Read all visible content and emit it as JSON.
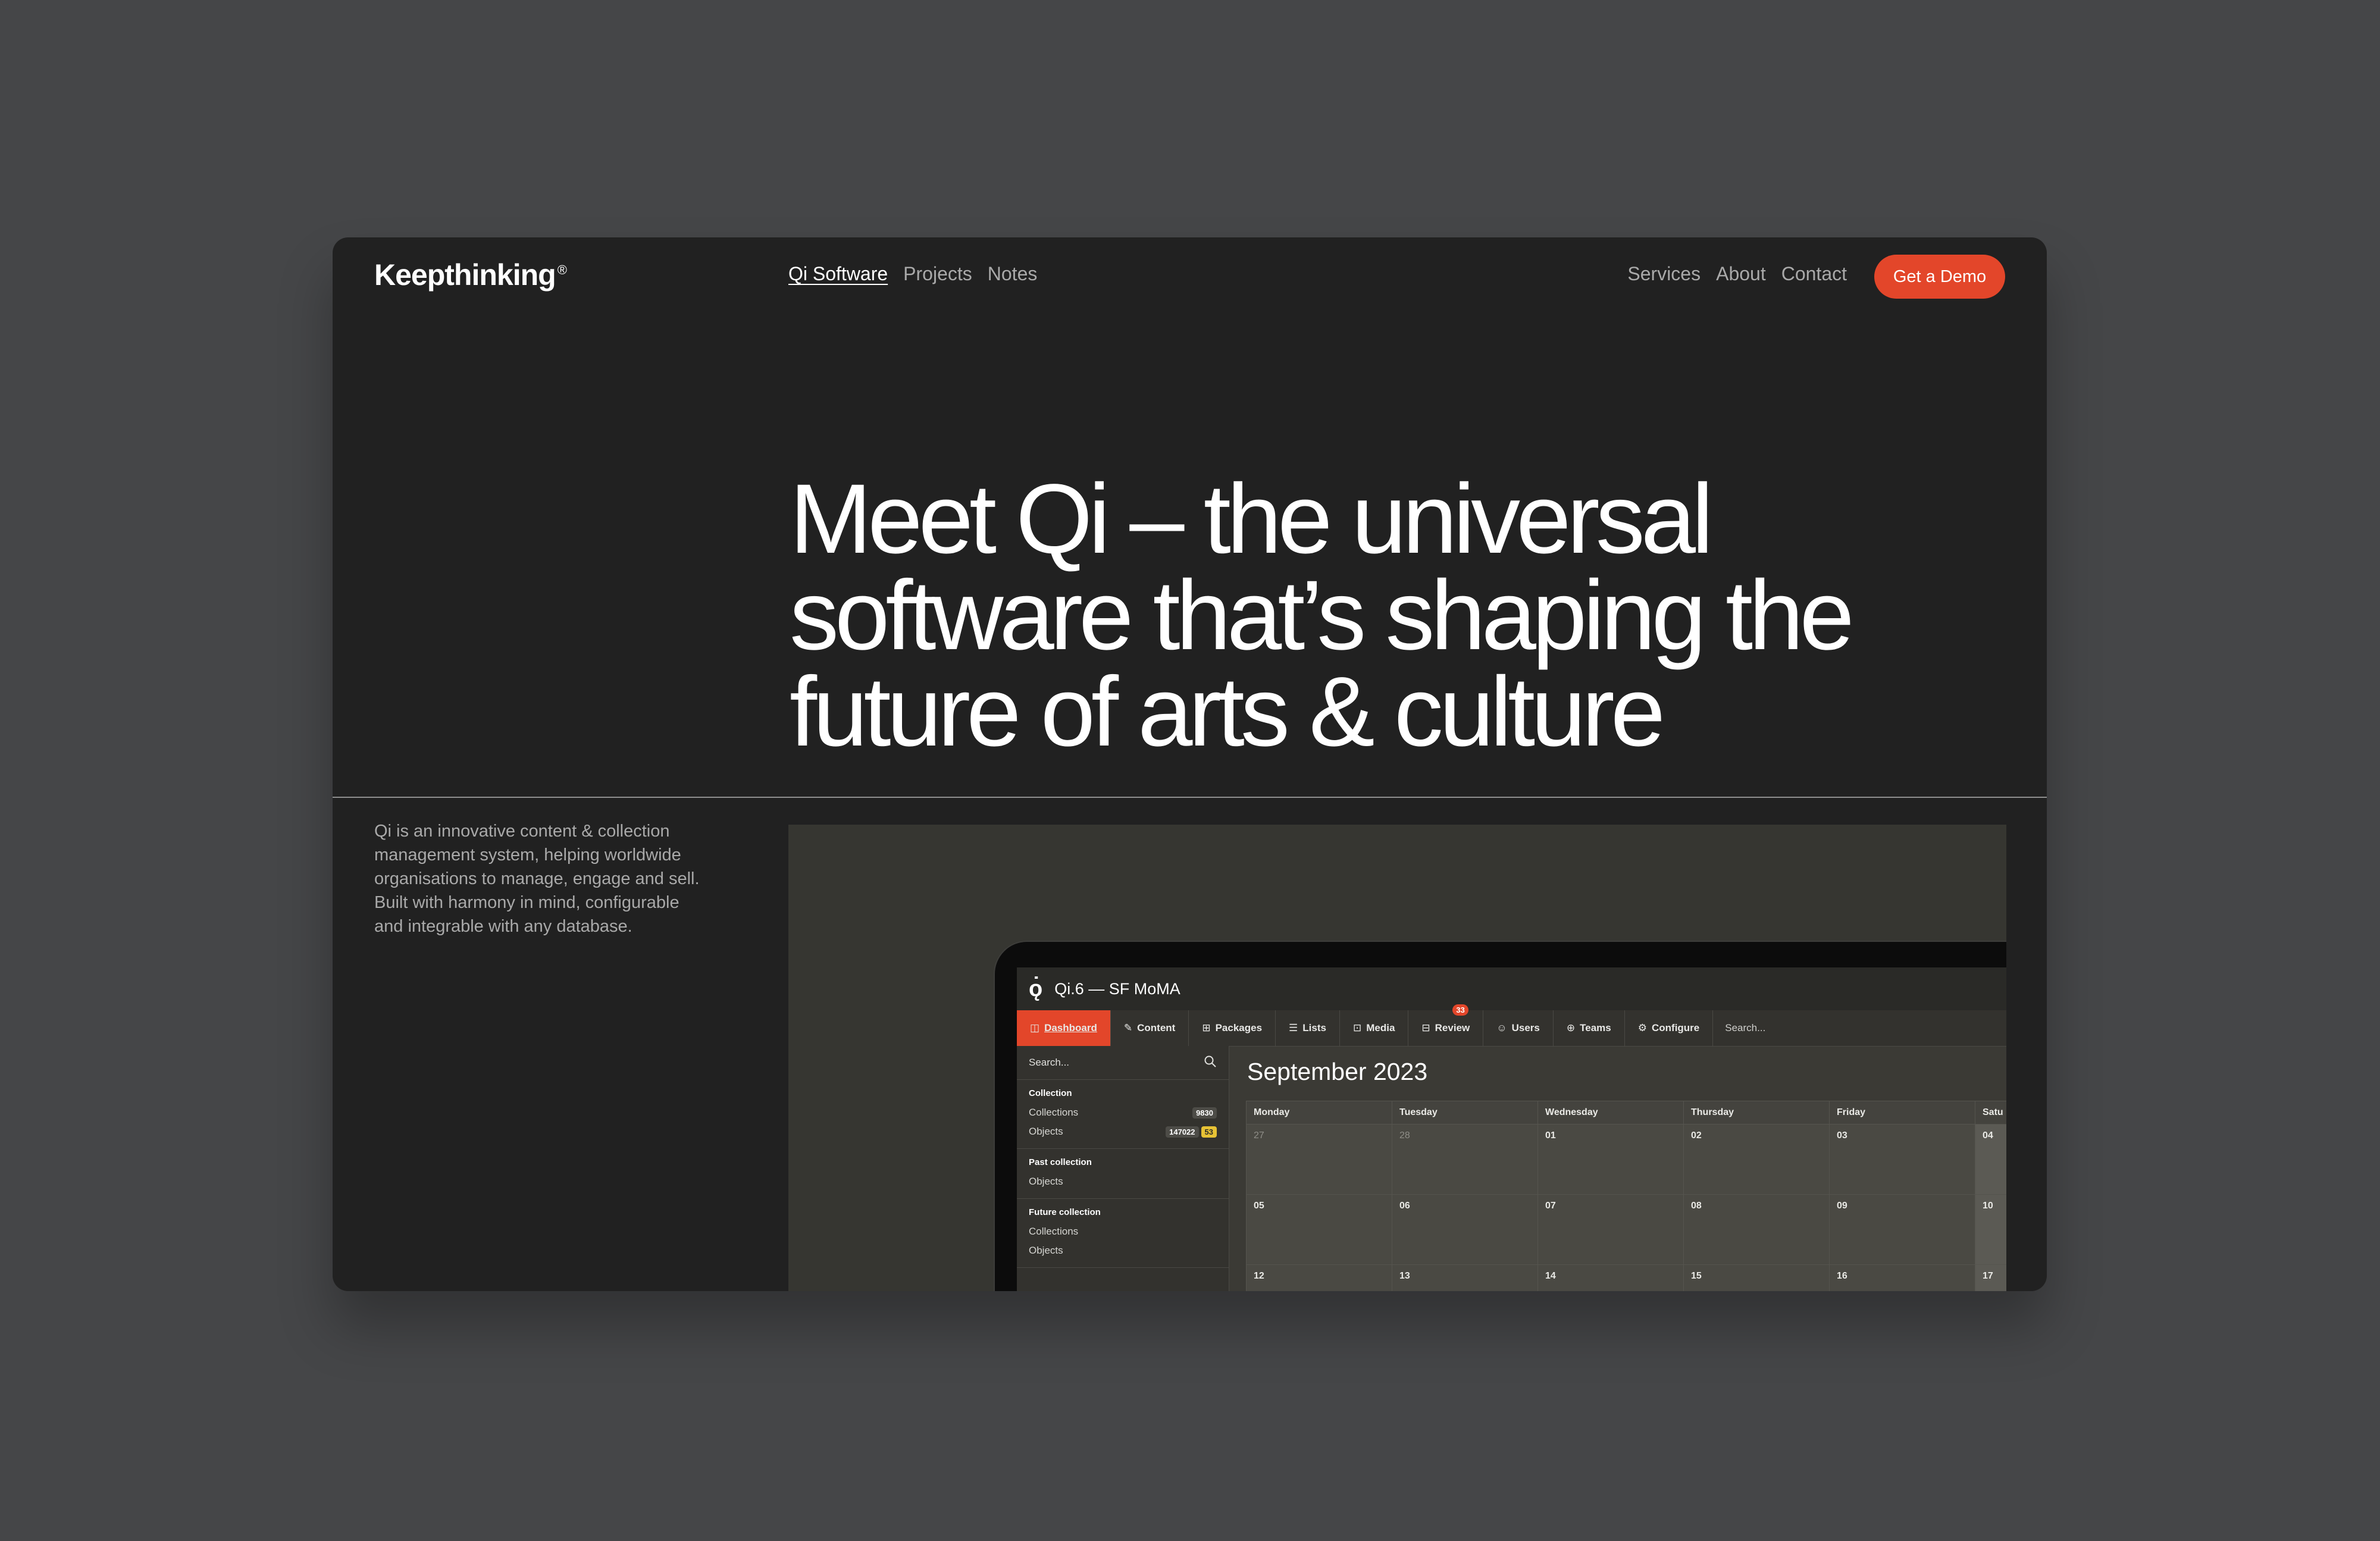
{
  "site": {
    "logo": "Keepthinking",
    "logo_mark": "®",
    "nav_left": [
      {
        "label": "Qi Software",
        "active": true
      },
      {
        "label": "Projects",
        "active": false
      },
      {
        "label": "Notes",
        "active": false
      }
    ],
    "nav_right": [
      {
        "label": "Services"
      },
      {
        "label": "About"
      },
      {
        "label": "Contact"
      }
    ],
    "cta": "Get a Demo",
    "accent": "#e3462a"
  },
  "hero": {
    "lines": [
      "Meet Qi – the universal",
      "software that’s shaping the",
      "future of arts & culture"
    ]
  },
  "blurb": {
    "lines": [
      "Qi is an innovative content & collection",
      "management system, helping worldwide",
      "organisations to manage, engage and sell.",
      "Built with harmony in mind, configurable",
      "and integrable with any database."
    ]
  },
  "app": {
    "logo": "ǫ̇",
    "title": "Qi.6 — SF MoMA",
    "tabs": [
      {
        "label": "Dashboard",
        "icon": "◫",
        "icon_name": "dashboard-icon",
        "active": true
      },
      {
        "label": "Content",
        "icon": "✎",
        "icon_name": "content-icon"
      },
      {
        "label": "Packages",
        "icon": "⊞",
        "icon_name": "packages-icon"
      },
      {
        "label": "Lists",
        "icon": "☰",
        "icon_name": "lists-icon"
      },
      {
        "label": "Media",
        "icon": "⊡",
        "icon_name": "media-icon"
      },
      {
        "label": "Review",
        "icon": "⊟",
        "icon_name": "review-icon",
        "badge": "33"
      },
      {
        "label": "Users",
        "icon": "☺",
        "icon_name": "users-icon"
      },
      {
        "label": "Teams",
        "icon": "⊕",
        "icon_name": "teams-icon"
      },
      {
        "label": "Configure",
        "icon": "⚙",
        "icon_name": "configure-icon"
      }
    ],
    "top_search_placeholder": "Search...",
    "sidebar": {
      "search_placeholder": "Search...",
      "groups": [
        {
          "heading": "Collection",
          "items": [
            {
              "label": "Collections",
              "count": "9830"
            },
            {
              "label": "Objects",
              "count": "147022",
              "alert": "53"
            }
          ]
        },
        {
          "heading": "Past collection",
          "items": [
            {
              "label": "Objects"
            }
          ]
        },
        {
          "heading": "Future collection",
          "items": [
            {
              "label": "Collections"
            },
            {
              "label": "Objects"
            }
          ]
        }
      ]
    },
    "calendar": {
      "month": "September 2023",
      "days": [
        "Monday",
        "Tuesday",
        "Wednesday",
        "Thursday",
        "Friday",
        "Satu"
      ],
      "weeks": [
        [
          "27",
          "28",
          "01",
          "02",
          "03",
          "04"
        ],
        [
          "05",
          "06",
          "07",
          "08",
          "09",
          "10"
        ],
        [
          "12",
          "13",
          "14",
          "15",
          "16",
          "17"
        ]
      ]
    }
  }
}
